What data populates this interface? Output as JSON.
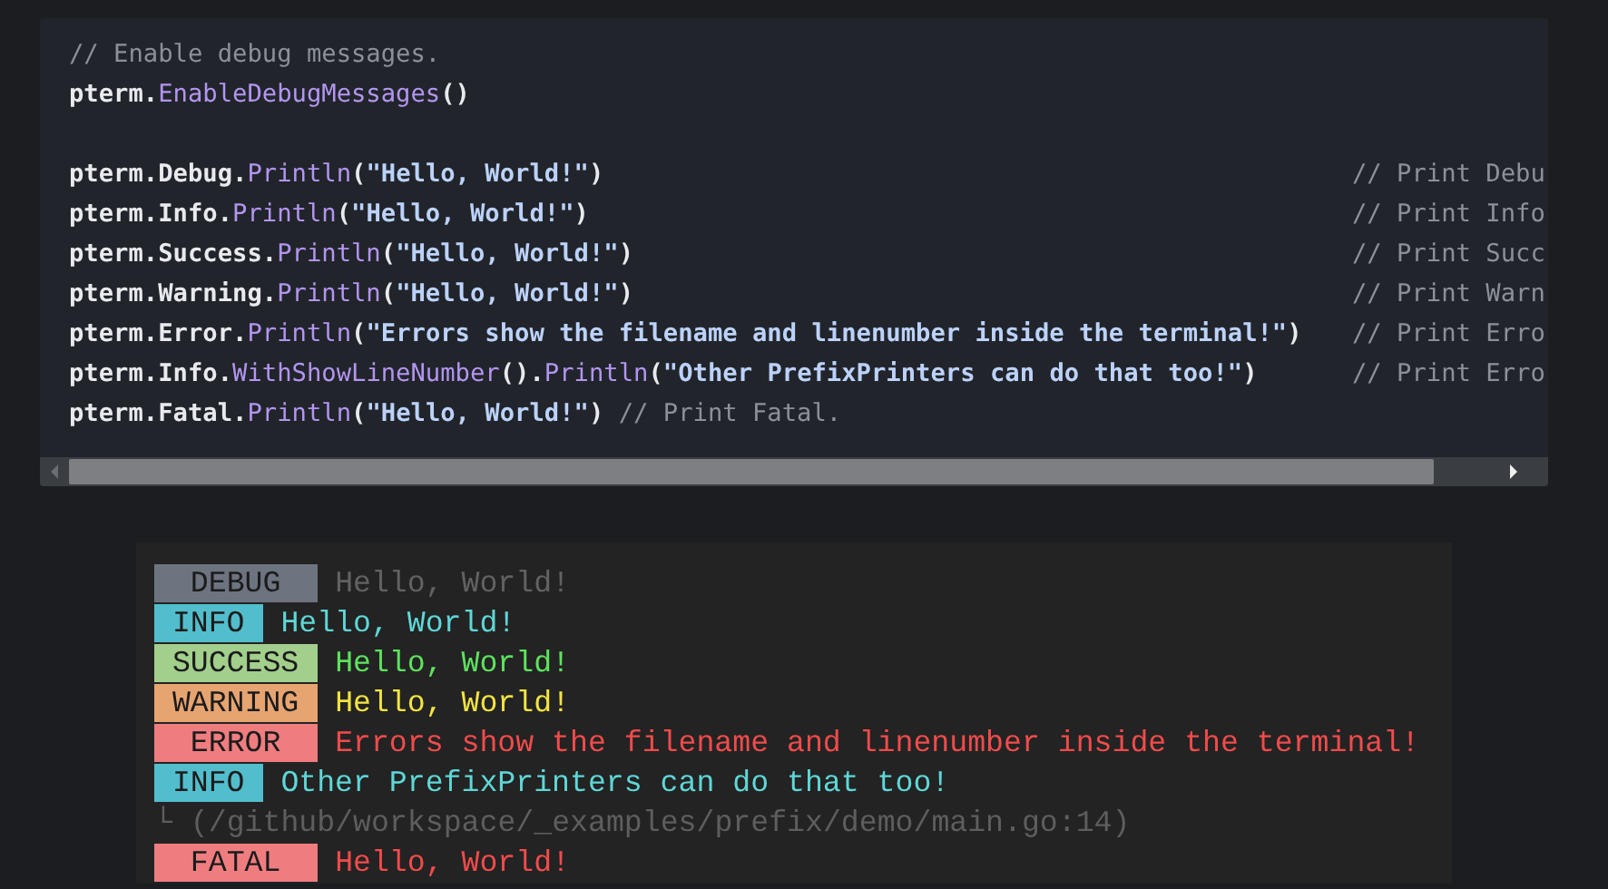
{
  "code_block": {
    "lines": [
      {
        "kind": "code",
        "parts": [
          {
            "kind": "comment",
            "text": "// Enable debug messages."
          }
        ]
      },
      {
        "kind": "code",
        "parts": [
          {
            "kind": "plain",
            "text": "pterm."
          },
          {
            "kind": "method",
            "text": "EnableDebugMessages"
          },
          {
            "kind": "plain",
            "text": "()"
          }
        ]
      },
      {
        "kind": "blank"
      },
      {
        "kind": "code",
        "parts": [
          {
            "kind": "plain",
            "text": "pterm.Debug."
          },
          {
            "kind": "method",
            "text": "Println"
          },
          {
            "kind": "plain",
            "text": "("
          },
          {
            "kind": "string",
            "text": "\"Hello, World!\""
          },
          {
            "kind": "plain",
            "text": ")"
          }
        ],
        "side_comment": "// Print Debu"
      },
      {
        "kind": "code",
        "parts": [
          {
            "kind": "plain",
            "text": "pterm.Info."
          },
          {
            "kind": "method",
            "text": "Println"
          },
          {
            "kind": "plain",
            "text": "("
          },
          {
            "kind": "string",
            "text": "\"Hello, World!\""
          },
          {
            "kind": "plain",
            "text": ")"
          }
        ],
        "side_comment": "// Print Info"
      },
      {
        "kind": "code",
        "parts": [
          {
            "kind": "plain",
            "text": "pterm.Success."
          },
          {
            "kind": "method",
            "text": "Println"
          },
          {
            "kind": "plain",
            "text": "("
          },
          {
            "kind": "string",
            "text": "\"Hello, World!\""
          },
          {
            "kind": "plain",
            "text": ")"
          }
        ],
        "side_comment": "// Print Succ"
      },
      {
        "kind": "code",
        "parts": [
          {
            "kind": "plain",
            "text": "pterm.Warning."
          },
          {
            "kind": "method",
            "text": "Println"
          },
          {
            "kind": "plain",
            "text": "("
          },
          {
            "kind": "string",
            "text": "\"Hello, World!\""
          },
          {
            "kind": "plain",
            "text": ")"
          }
        ],
        "side_comment": "// Print Warn"
      },
      {
        "kind": "code",
        "parts": [
          {
            "kind": "plain",
            "text": "pterm.Error."
          },
          {
            "kind": "method",
            "text": "Println"
          },
          {
            "kind": "plain",
            "text": "("
          },
          {
            "kind": "string",
            "text": "\"Errors show the filename and linenumber inside the terminal!\""
          },
          {
            "kind": "plain",
            "text": ")"
          }
        ],
        "side_comment": "// Print Erro"
      },
      {
        "kind": "code",
        "parts": [
          {
            "kind": "plain",
            "text": "pterm.Info."
          },
          {
            "kind": "method",
            "text": "WithShowLineNumber"
          },
          {
            "kind": "plain",
            "text": "()."
          },
          {
            "kind": "method",
            "text": "Println"
          },
          {
            "kind": "plain",
            "text": "("
          },
          {
            "kind": "string",
            "text": "\"Other PrefixPrinters can do that too!\""
          },
          {
            "kind": "plain",
            "text": ")"
          }
        ],
        "side_comment": "// Print Erro"
      },
      {
        "kind": "code",
        "parts": [
          {
            "kind": "plain",
            "text": "pterm.Fatal."
          },
          {
            "kind": "method",
            "text": "Println"
          },
          {
            "kind": "plain",
            "text": "("
          },
          {
            "kind": "string",
            "text": "\"Hello, World!\""
          },
          {
            "kind": "plain",
            "text": ") "
          },
          {
            "kind": "comment",
            "text": "// Print Fatal."
          }
        ]
      }
    ]
  },
  "terminal": {
    "rows": [
      {
        "kind": "debug",
        "badge": "DEBUG",
        "message": "Hello, World!"
      },
      {
        "kind": "info",
        "badge": "INFO",
        "message": "Hello, World!"
      },
      {
        "kind": "success",
        "badge": "SUCCESS",
        "message": "Hello, World!"
      },
      {
        "kind": "warning",
        "badge": "WARNING",
        "message": "Hello, World!"
      },
      {
        "kind": "error",
        "badge": "ERROR",
        "message": "Errors show the filename and linenumber inside the terminal!"
      },
      {
        "kind": "info",
        "badge": "INFO",
        "message": "Other PrefixPrinters can do that too!"
      },
      {
        "kind": "trace",
        "message": "└ (/github/workspace/_examples/prefix/demo/main.go:14)"
      },
      {
        "kind": "fatal",
        "badge": "FATAL",
        "message": "Hello, World!"
      }
    ]
  }
}
